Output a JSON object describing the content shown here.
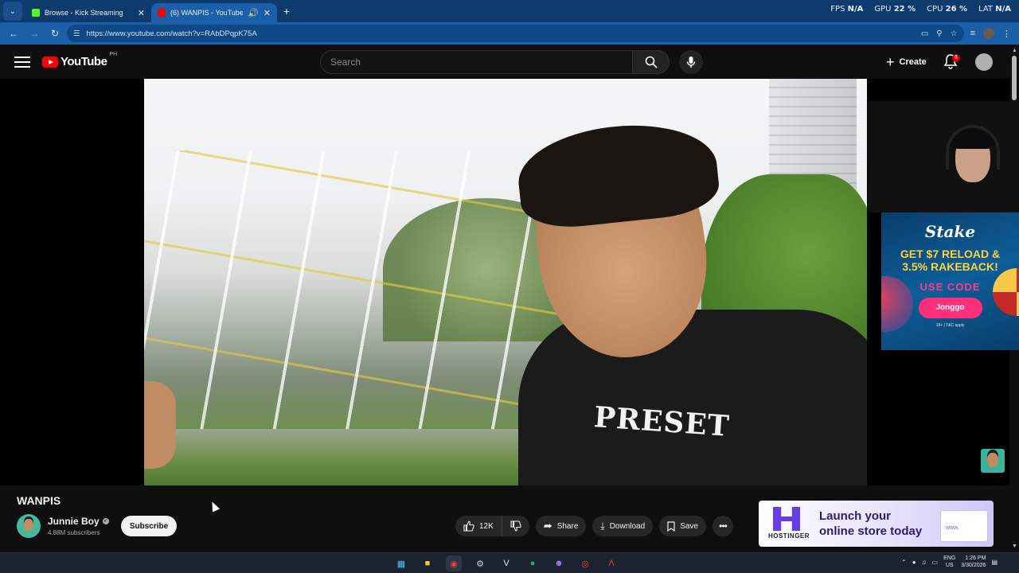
{
  "browser": {
    "tabs": [
      {
        "title": "Browse - Kick Streaming",
        "active": false,
        "favicon_color": "#53fc18"
      },
      {
        "title": "(6) WANPIS - YouTube",
        "active": true,
        "favicon_color": "#ff0000"
      }
    ],
    "new_tab_label": "+",
    "url": "https://www.youtube.com/watch?v=RAbDPqpK75A"
  },
  "hud": {
    "fps_label": "FPS",
    "fps_value": "N/A",
    "gpu_label": "GPU",
    "gpu_value": "22 %",
    "cpu_label": "CPU",
    "cpu_value": "26 %",
    "lat_label": "LAT",
    "lat_value": "N/A"
  },
  "youtube": {
    "logo_text": "YouTube",
    "region": "PH",
    "search_placeholder": "Search",
    "create_label": "Create",
    "notification_count": "6"
  },
  "overlay": {
    "stake": {
      "logo": "Stake",
      "headline_line1": "GET $7 RELOAD &",
      "headline_line2": "3.5% RAKEBACK!",
      "code_label": "USE CODE",
      "code": "Jonggo",
      "fine_print": "18+ | T&C apply"
    }
  },
  "video": {
    "shirt_text": "PRESET",
    "title": "WANPIS",
    "channel_name": "Junnie Boy",
    "subscribers": "4.88M subscribers",
    "subscribe_label": "Subscribe",
    "likes": "12K",
    "share_label": "Share",
    "download_label": "Download",
    "save_label": "Save"
  },
  "ad": {
    "brand": "HOSTINGER",
    "headline_line1": "Launch your",
    "headline_line2": "online store today",
    "window_text": "www."
  },
  "taskbar": {
    "lang_line1": "ENG",
    "lang_line2": "US",
    "time": "1:26 PM",
    "date": "3/30/2026"
  }
}
